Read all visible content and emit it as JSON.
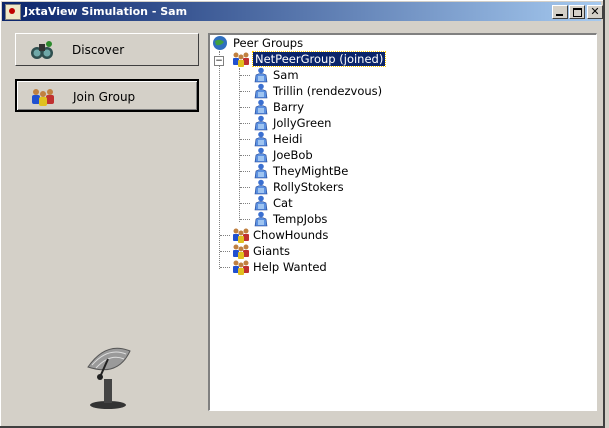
{
  "window": {
    "title": "JxtaView Simulation - Sam"
  },
  "buttons": {
    "discover": {
      "label": "Discover"
    },
    "join_group": {
      "label": "Join Group"
    }
  },
  "tree": {
    "root": "Peer Groups",
    "selected_group": "NetPeerGroup   (joined)",
    "peers": [
      "Sam",
      "Trillin   (rendezvous)",
      "Barry",
      "JollyGreen",
      "Heidi",
      "JoeBob",
      "TheyMightBe",
      "RollyStokers",
      "Cat",
      "TempJobs"
    ],
    "groups": [
      "ChowHounds",
      "Giants",
      "Help Wanted"
    ]
  },
  "icons": {
    "app": "jxta-app-icon",
    "discover": "binoculars-icon",
    "join": "group-people-icon",
    "root": "globe-icon",
    "group": "group-people-icon",
    "peer": "person-icon",
    "footer": "satellite-dish-icon"
  }
}
